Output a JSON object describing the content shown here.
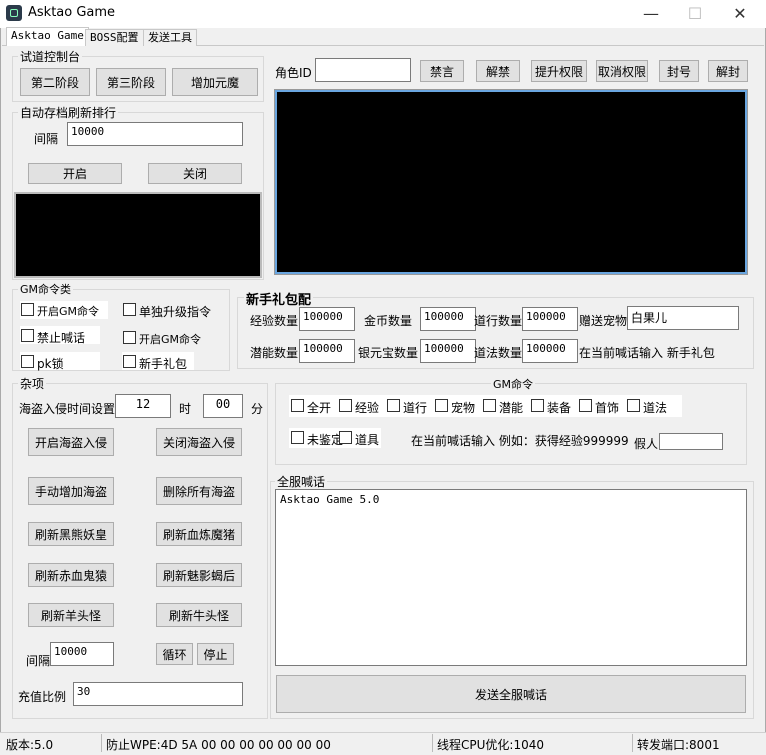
{
  "window": {
    "title": "Asktao Game",
    "minimize": "—",
    "maximize": "☐",
    "close": "✕"
  },
  "tabs": [
    "Asktao Game",
    "BOSS配置",
    "发送工具"
  ],
  "trial": {
    "group_label": "试道控制台",
    "buttons": [
      "第二阶段",
      "第三阶段",
      "增加元魔"
    ]
  },
  "autosave": {
    "group_label": "自动存档刷新排行",
    "interval_label": "间隔",
    "interval_value": "10000",
    "start_button": "开启",
    "stop_button": "关闭"
  },
  "role": {
    "label": "角色ID",
    "value": "",
    "buttons": [
      "禁言",
      "解禁",
      "提升权限",
      "取消权限",
      "封号",
      "解封"
    ]
  },
  "gm_class": {
    "group_label": "GM命令类",
    "left_items": [
      "开启GM命令",
      "禁止喊话",
      "pk锁"
    ],
    "right_items": [
      "单独升级指令",
      "开启GM命令",
      "新手礼包"
    ]
  },
  "gift": {
    "title": "新手礼包配",
    "row1": [
      {
        "label": "经验数量",
        "value": "100000"
      },
      {
        "label": "金币数量",
        "value": "100000"
      },
      {
        "label": "道行数量",
        "value": "100000"
      },
      {
        "label": "赠送宠物",
        "value": "白果儿"
      }
    ],
    "row2": [
      {
        "label": "潜能数量",
        "value": "100000"
      },
      {
        "label": "银元宝数量",
        "value": "100000"
      },
      {
        "label": "道法数量",
        "value": "100000"
      }
    ],
    "hint": "在当前喊话输入 新手礼包"
  },
  "misc": {
    "group_label": "杂项",
    "pirate_time_label": "海盗入侵时间设置",
    "hour_value": "12",
    "hour_unit": "时",
    "minute_value": "00",
    "minute_unit": "分",
    "buttons_left": [
      "开启海盗入侵",
      "手动增加海盗",
      "刷新黑熊妖皇",
      "刷新赤血鬼猿",
      "刷新羊头怪"
    ],
    "buttons_right": [
      "关闭海盗入侵",
      "删除所有海盗",
      "刷新血炼魔猪",
      "刷新魅影蝎后",
      "刷新牛头怪"
    ],
    "interval_label": "间隔",
    "interval_value": "10000",
    "loop_button": "循环",
    "stop_button": "停止",
    "ratio_label": "充值比例",
    "ratio_value": "30"
  },
  "gm_cmd": {
    "group_label": "GM命令",
    "row1": [
      "全开",
      "经验",
      "道行",
      "宠物",
      "潜能",
      "装备",
      "首饰",
      "道法"
    ],
    "row2": [
      "未鉴定",
      "道具"
    ],
    "hint": "在当前喊话输入 例如：获得经验999999",
    "fake_label": "假人",
    "fake_value": ""
  },
  "broadcast": {
    "group_label": "全服喊话",
    "content": "Asktao Game 5.0",
    "send_button": "发送全服喊话"
  },
  "statusbar": {
    "version": "版本:5.0",
    "wpe": "防止WPE:4D 5A 00 00 00 00 00 00 00",
    "cpu": "线程CPU优化:1040",
    "port": "转发端口:8001"
  }
}
